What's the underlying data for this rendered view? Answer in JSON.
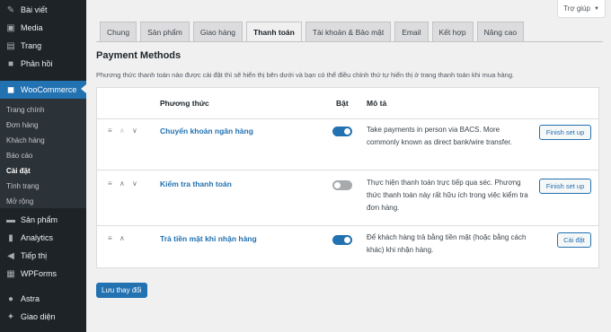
{
  "sidebar": {
    "items": [
      {
        "label": "Bài viết",
        "icon": "pin-icon"
      },
      {
        "label": "Media",
        "icon": "media-icon"
      },
      {
        "label": "Trang",
        "icon": "page-icon"
      },
      {
        "label": "Phản hồi",
        "icon": "comment-icon"
      },
      {
        "label": "WooCommerce",
        "icon": "woo-icon"
      },
      {
        "label": "Sản phẩm",
        "icon": "products-icon"
      },
      {
        "label": "Analytics",
        "icon": "analytics-icon"
      },
      {
        "label": "Tiếp thị",
        "icon": "marketing-icon"
      },
      {
        "label": "WPForms",
        "icon": "forms-icon"
      },
      {
        "label": "Astra",
        "icon": "astra-icon"
      },
      {
        "label": "Giao diện",
        "icon": "appearance-icon"
      }
    ],
    "submenu": [
      "Trang chính",
      "Đơn hàng",
      "Khách hàng",
      "Báo cáo",
      "Cài đặt",
      "Tình trạng",
      "Mở rộng"
    ],
    "active_color": "#2271b1"
  },
  "help_tab": {
    "label": "Trợ giúp"
  },
  "tabs": [
    "Chung",
    "Sản phẩm",
    "Giao hàng",
    "Thanh toán",
    "Tài khoản & Bảo mật",
    "Email",
    "Kết hợp",
    "Nâng cao"
  ],
  "page": {
    "title": "Payment Methods",
    "description": "Phương thức thanh toán nào được cài đặt thì sẽ hiển thị bên dưới và bạn có thể điều chỉnh thứ tự hiển thị ở trang thanh toán khi mua hàng."
  },
  "table": {
    "headers": {
      "method": "Phương thức",
      "enabled": "Bật",
      "description": "Mô tả"
    },
    "rows": [
      {
        "name": "Chuyển khoản ngân hàng",
        "enabled": true,
        "description": "Take payments in person via BACS. More commonly known as direct bank/wire transfer.",
        "action": "Finish set up"
      },
      {
        "name": "Kiểm tra thanh toán",
        "enabled": false,
        "description": "Thực hiện thanh toán trực tiếp qua séc. Phương thức thanh toán này rất hữu ích trong việc kiểm tra đơn hàng.",
        "action": "Finish set up"
      },
      {
        "name": "Trả tiền mặt khi nhận hàng",
        "enabled": true,
        "description": "Để khách hàng trả bằng tiền mặt (hoặc bằng cách khác) khi nhận hàng.",
        "action": "Cài đặt"
      }
    ]
  },
  "save_button": {
    "label": "Lưu thay đổi"
  }
}
